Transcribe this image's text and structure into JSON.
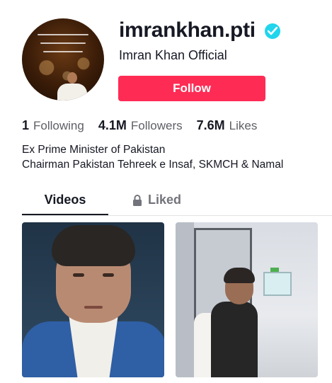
{
  "profile": {
    "username": "imrankhan.pti",
    "nickname": "Imran Khan Official",
    "verified": true,
    "follow_label": "Follow"
  },
  "stats": [
    {
      "value": "1",
      "label": "Following"
    },
    {
      "value": "4.1M",
      "label": "Followers"
    },
    {
      "value": "7.6M",
      "label": "Likes"
    }
  ],
  "bio": {
    "line1": "Ex Prime Minister of Pakistan",
    "line2": "Chairman Pakistan Tehreek e Insaf, SKMCH & Namal"
  },
  "tabs": {
    "videos": "Videos",
    "liked": "Liked",
    "active": "videos"
  },
  "icons": {
    "verified": "verified-badge-icon",
    "liked_lock": "lock-icon"
  },
  "colors": {
    "accent": "#fe2c55",
    "verified": "#20d5ec",
    "text": "#161823",
    "secondary_text": "#5e5f66"
  }
}
